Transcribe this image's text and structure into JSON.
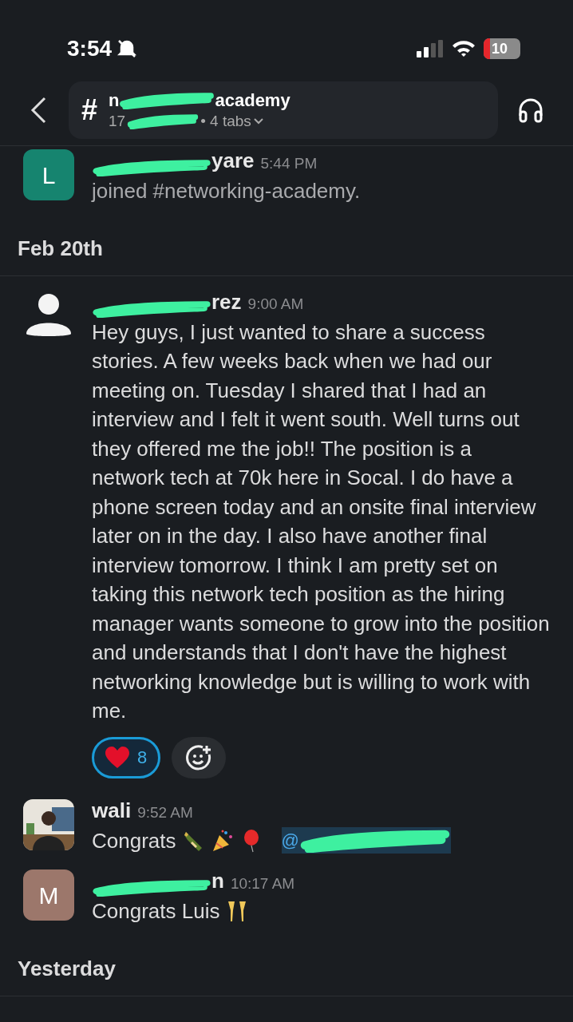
{
  "status_bar": {
    "time": "3:54",
    "battery": "10"
  },
  "header": {
    "channel_prefix": "#",
    "channel_start": "n",
    "channel_end": "academy",
    "subtitle_start": "17",
    "subtitle_end": "• 4 tabs"
  },
  "messages": [
    {
      "kind": "join",
      "avatar": {
        "kind": "letter",
        "letter": "L",
        "color": "#16846f"
      },
      "name_end": "yare",
      "time": "5:44 PM",
      "text": "joined #networking-academy."
    },
    {
      "kind": "date",
      "label": "Feb 20th"
    },
    {
      "kind": "post",
      "avatar": {
        "kind": "person"
      },
      "name_end": "rez",
      "time": "9:00 AM",
      "text": "Hey guys, I just wanted to share a success stories. A few weeks back when we had our meeting on. Tuesday I shared that I had an interview and I felt it went south. Well turns out they offered me the job!! The position is a network tech at 70k here in Socal. I do have a phone screen today and an onsite final interview later on in the day. I also have another final interview tomorrow. I think I am pretty set on taking this network tech position as the hiring manager wants someone to grow into the position and understands that I don't have the highest networking knowledge but is willing to work with me.",
      "reactions": [
        {
          "count": "8",
          "selected": true
        }
      ]
    },
    {
      "kind": "post",
      "name": "wali",
      "time": "9:52 AM",
      "text": "Congrats",
      "emojis": [
        {
          "kind": "bottle"
        },
        {
          "kind": "popper"
        },
        {
          "kind": "balloon"
        }
      ],
      "mention": "@"
    },
    {
      "kind": "post",
      "avatar": {
        "kind": "letter",
        "letter": "M",
        "color": "#9c776b"
      },
      "name_end": "n",
      "time": "10:17 AM",
      "text": "Congrats Luis",
      "emojis": [
        {
          "kind": "glasses"
        }
      ]
    },
    {
      "kind": "date",
      "label": "Yesterday"
    }
  ]
}
